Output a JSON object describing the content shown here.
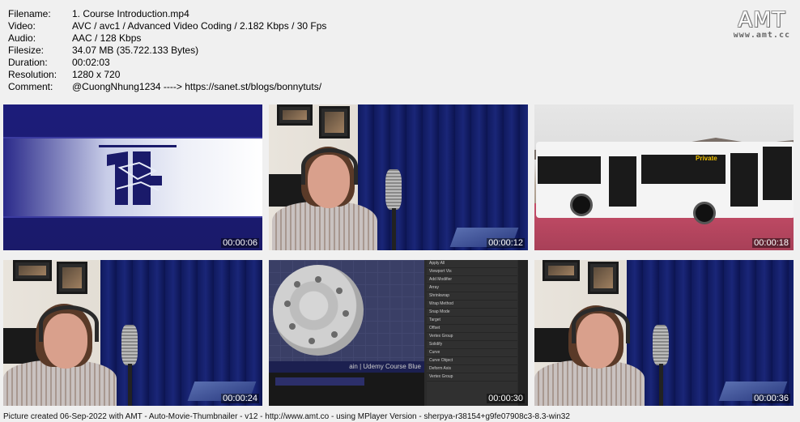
{
  "info": [
    {
      "key": "Filename:",
      "value": "1. Course Introduction.mp4"
    },
    {
      "key": "Video:",
      "value": "AVC / avc1 / Advanced Video Coding / 2.182 Kbps / 30 Fps"
    },
    {
      "key": "Audio:",
      "value": "AAC / 128 Kbps"
    },
    {
      "key": "Filesize:",
      "value": "34.07 MB (35.722.133 Bytes)"
    },
    {
      "key": "Duration:",
      "value": "00:02:03"
    },
    {
      "key": "Resolution:",
      "value": "1280 x 720"
    },
    {
      "key": "Comment:",
      "value": "@CuongNhung1234 ----> https://sanet.st/blogs/bonnytuts/"
    }
  ],
  "logo": {
    "big": "AMT",
    "small": "www.amt.cc"
  },
  "thumbs": [
    {
      "time": "00:00:06",
      "scene": "intro"
    },
    {
      "time": "00:00:12",
      "scene": "presenter"
    },
    {
      "time": "00:00:18",
      "scene": "bus"
    },
    {
      "time": "00:00:24",
      "scene": "presenter"
    },
    {
      "time": "00:00:30",
      "scene": "blender"
    },
    {
      "time": "00:00:36",
      "scene": "presenter"
    }
  ],
  "bus_label": "Private",
  "blender": {
    "banner": "ain | Udemy Course Blue",
    "rows": [
      "Apply All",
      "Viewport Vis",
      "Add Modifier",
      "Array",
      "Shrinkwrap",
      "Wrap Method",
      "Snap Mode",
      "Target",
      "Offset",
      "Vertex Group",
      "Solidify",
      "Curve",
      "Curve Object",
      "Deform Axis",
      "Vertex Group"
    ]
  },
  "footer": "Picture created 06-Sep-2022 with AMT - Auto-Movie-Thumbnailer - v12 - http://www.amt.co - using MPlayer Version - sherpya-r38154+g9fe07908c3-8.3-win32"
}
